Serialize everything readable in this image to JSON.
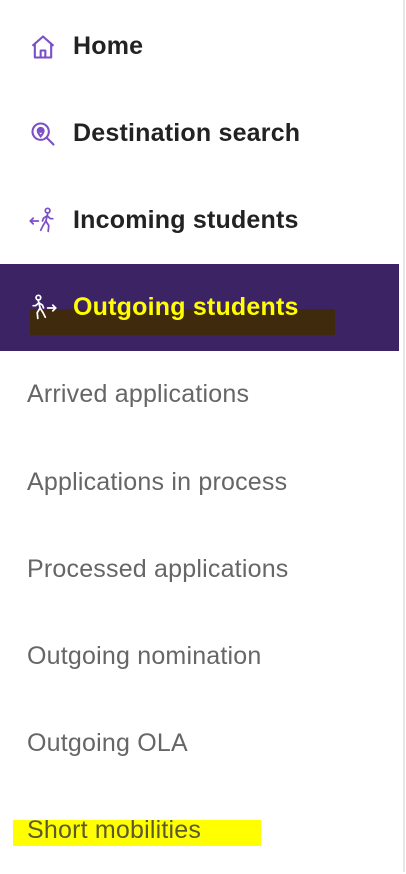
{
  "colors": {
    "accent_purple": "#7b4fc7",
    "active_background": "#3c2363",
    "active_text": "#ffff00",
    "highlight_yellow": "#ffff00",
    "main_text": "#222222",
    "sub_text": "#666666"
  },
  "nav": {
    "main_items": [
      {
        "label": "Home",
        "icon": "home-icon"
      },
      {
        "label": "Destination search",
        "icon": "location-search-icon"
      },
      {
        "label": "Incoming students",
        "icon": "walking-person-incoming-icon"
      },
      {
        "label": "Outgoing students",
        "icon": "walking-person-outgoing-icon",
        "active": true
      }
    ],
    "sub_items": [
      {
        "label": "Arrived applications"
      },
      {
        "label": "Applications in process"
      },
      {
        "label": "Processed applications"
      },
      {
        "label": "Outgoing nomination"
      },
      {
        "label": "Outgoing OLA"
      },
      {
        "label": "Short mobilities",
        "highlighted": true
      }
    ]
  }
}
